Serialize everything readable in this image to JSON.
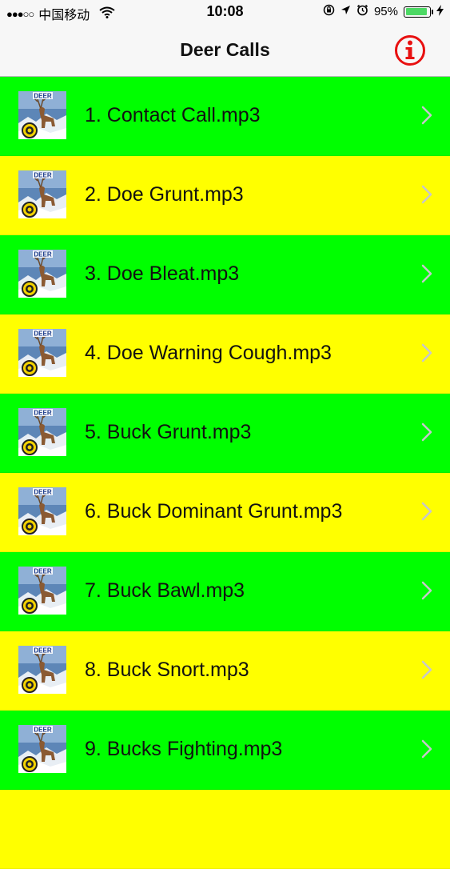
{
  "status_bar": {
    "signal": "●●●○○",
    "carrier": "中国移动",
    "time": "10:08",
    "battery_percent": "95%",
    "battery_level": 0.95,
    "icons": [
      "wifi-icon",
      "rotation-lock-icon",
      "location-arrow-icon",
      "alarm-icon",
      "battery-icon",
      "charging-bolt-icon"
    ]
  },
  "nav": {
    "title": "Deer Calls",
    "info_icon": "info-icon"
  },
  "colors": {
    "green": "#00ff00",
    "yellow": "#ffff00",
    "info_red": "#e81010",
    "chevron": "#c7c7cc"
  },
  "list": {
    "items": [
      {
        "label": "1. Contact Call.mp3",
        "color": "#00ff00",
        "thumb_text": "DEER"
      },
      {
        "label": "2. Doe Grunt.mp3",
        "color": "#ffff00",
        "thumb_text": "DEER"
      },
      {
        "label": "3. Doe Bleat.mp3",
        "color": "#00ff00",
        "thumb_text": "DEER"
      },
      {
        "label": "4. Doe Warning Cough.mp3",
        "color": "#ffff00",
        "thumb_text": "DEER"
      },
      {
        "label": "5. Buck Grunt.mp3",
        "color": "#00ff00",
        "thumb_text": "DEER"
      },
      {
        "label": "6. Buck Dominant Grunt.mp3",
        "color": "#ffff00",
        "thumb_text": "DEER"
      },
      {
        "label": "7. Buck Bawl.mp3",
        "color": "#00ff00",
        "thumb_text": "DEER"
      },
      {
        "label": "8. Buck Snort.mp3",
        "color": "#ffff00",
        "thumb_text": "DEER"
      },
      {
        "label": "9. Bucks Fighting.mp3",
        "color": "#00ff00",
        "thumb_text": "DEER"
      },
      {
        "label": "",
        "color": "#ffff00",
        "thumb_text": ""
      }
    ]
  }
}
